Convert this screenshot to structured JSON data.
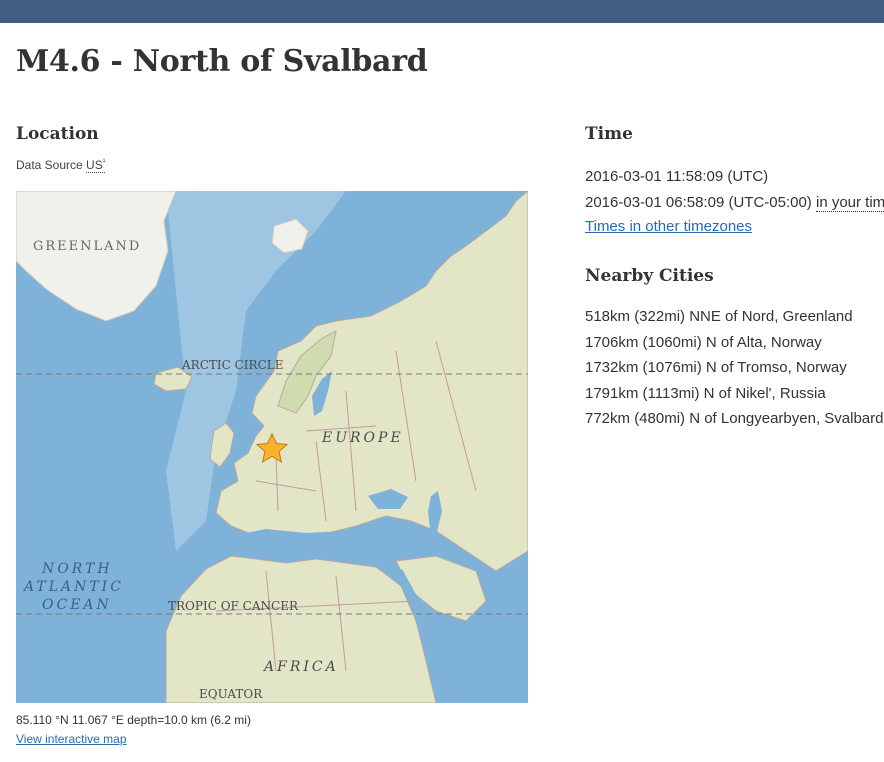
{
  "header": {
    "title": "M4.6 - North of Svalbard"
  },
  "location": {
    "heading": "Location",
    "data_source_label": "Data Source",
    "data_source_value": "US",
    "data_source_sup": "¹",
    "map": {
      "labels": {
        "greenland": "GREENLAND",
        "arctic_circle": "ARCTIC CIRCLE",
        "europe": "EUROPE",
        "north": "NORTH",
        "atlantic": "ATLANTIC",
        "ocean": "OCEAN",
        "tropic": "TROPIC OF CANCER",
        "africa": "AFRICA",
        "equator": "EQUATOR"
      },
      "marker_icon": "star-icon",
      "colors": {
        "ocean": "#7fb2d8",
        "land": "#e3e6c6",
        "ice": "#f1f1ec",
        "marker": "#f7b42c"
      }
    },
    "coordinates": "85.110 °N 11.067 °E depth=10.0 km (6.2 mi)",
    "interactive_map_link": "View interactive map"
  },
  "time": {
    "heading": "Time",
    "utc": "2016-03-01 11:58:09 (UTC)",
    "local": "2016-03-01 06:58:09 (UTC-05:00)",
    "local_suffix": "in your timezone",
    "other_timezones_link": "Times in other timezones"
  },
  "nearby": {
    "heading": "Nearby Cities",
    "cities": [
      "518km (322mi) NNE of Nord, Greenland",
      "1706km (1060mi) N of Alta, Norway",
      "1732km (1076mi) N of Tromso, Norway",
      "1791km (1113mi) N of Nikel', Russia",
      "772km (480mi) N of Longyearbyen, Svalbard"
    ]
  }
}
